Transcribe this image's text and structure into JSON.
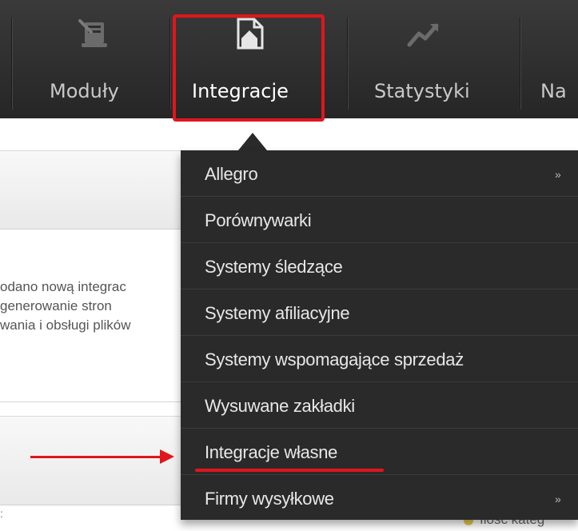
{
  "nav": {
    "items": [
      {
        "label": "Moduły",
        "icon": "modules-icon"
      },
      {
        "label": "Integracje",
        "icon": "integration-house-icon",
        "active": true
      },
      {
        "label": "Statystyki",
        "icon": "trend-up-icon"
      },
      {
        "label": "Na"
      }
    ]
  },
  "background": {
    "notice_lines": [
      "odano nową integrac",
      "generowanie stron",
      "wania i obsługi plików"
    ],
    "bottom_glyph": ":",
    "peek_text": "Ilość kateg"
  },
  "dropdown": {
    "items": [
      {
        "label": "Allegro",
        "submenu": "»"
      },
      {
        "label": "Porównywarki"
      },
      {
        "label": "Systemy śledzące"
      },
      {
        "label": "Systemy afiliacyjne"
      },
      {
        "label": "Systemy wspomagające sprzedaż"
      },
      {
        "label": "Wysuwane zakładki"
      },
      {
        "label": "Integracje własne",
        "highlighted": true
      },
      {
        "label": "Firmy wysyłkowe",
        "submenu": "»"
      }
    ]
  },
  "colors": {
    "nav_bg": "#2e2e2e",
    "menu_bg": "#2a2a2a",
    "annotation_red": "#e0161c"
  }
}
